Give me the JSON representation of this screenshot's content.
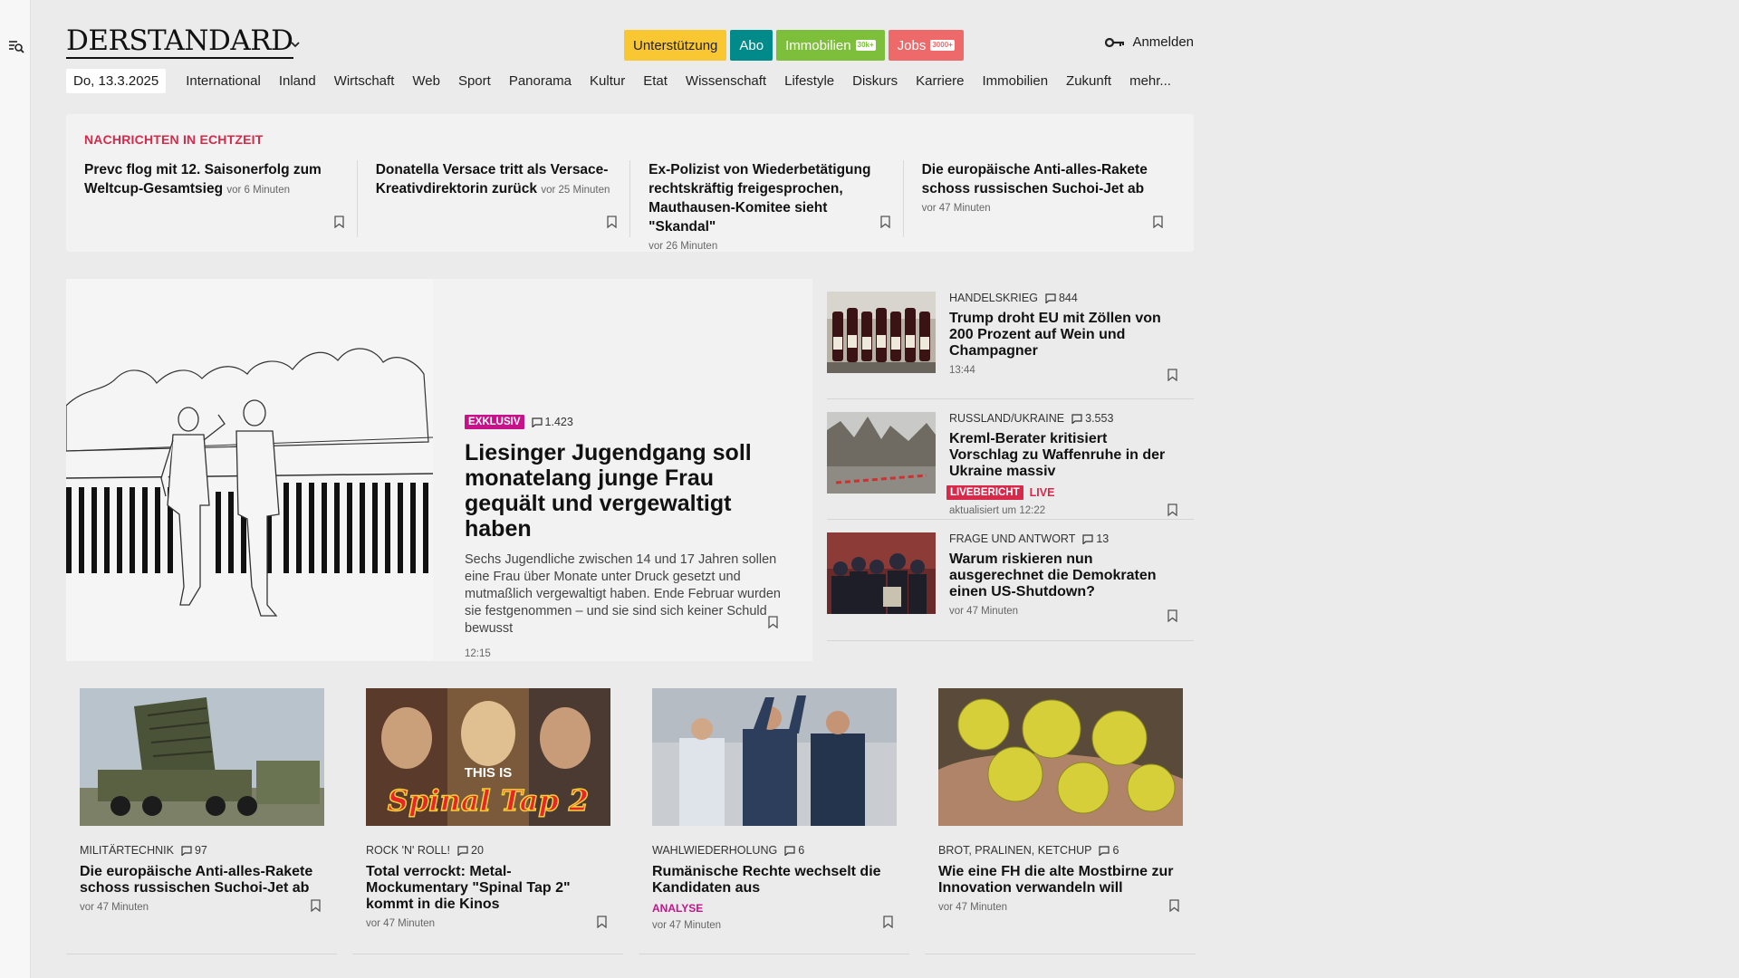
{
  "header": {
    "logo": "DERSTANDARD",
    "buttons": {
      "support": "Unterstützung",
      "abo": "Abo",
      "immobilien": "Immobilien",
      "immobilien_badge": "30k+",
      "jobs": "Jobs",
      "jobs_badge": "3000+"
    },
    "login": "Anmelden"
  },
  "nav": {
    "date": "Do, 13.3.2025",
    "items": [
      "International",
      "Inland",
      "Wirtschaft",
      "Web",
      "Sport",
      "Panorama",
      "Kultur",
      "Etat",
      "Wissenschaft",
      "Lifestyle",
      "Diskurs",
      "Karriere",
      "Immobilien",
      "Zukunft",
      "mehr..."
    ]
  },
  "realtime": {
    "title": "NACHRICHTEN IN ECHTZEIT",
    "items": [
      {
        "headline": "Prevc flog mit 12. Saisonerfolg zum Weltcup-Gesamtsieg",
        "time": "vor 6 Minuten"
      },
      {
        "headline": "Donatella Versace tritt als Versace-Kreativdirektorin zurück",
        "time": "vor 25 Minuten"
      },
      {
        "headline": "Ex-Polizist von Wiederbetätigung rechtskräftig freigesprochen, Mauthausen-Komitee sieht \"Skandal\"",
        "time": "vor 26 Minuten"
      },
      {
        "headline": "Die europäische Anti-alles-Rakete schoss russischen Suchoi-Jet ab",
        "time": "vor 47 Minuten"
      }
    ]
  },
  "hero": {
    "tag": "EXKLUSIV",
    "comments": "1.423",
    "title": "Liesinger Jugendgang soll monatelang junge Frau gequält und vergewaltigt haben",
    "teaser": "Sechs Jugendliche zwischen 14 und 17 Jahren sollen eine Frau über Monate unter Druck gesetzt und mutmaßlich vergewaltigt haben. Ende Februar wurden sie festgenommen – und sie sind sich keiner Schuld bewusst",
    "time": "12:15"
  },
  "side": [
    {
      "kicker": "Handelskrieg",
      "comments": "844",
      "title": "Trump droht EU mit Zöllen von 200 Prozent auf Wein und Champagner",
      "meta": "13:44"
    },
    {
      "kicker": "Russland/Ukraine",
      "comments": "3.553",
      "title": "Kreml-Berater kritisiert Vorschlag zu Waffenruhe in der Ukraine massiv",
      "live_tag": "LIVEBERICHT",
      "live_text": "LIVE",
      "meta": "aktualisiert um 12:22"
    },
    {
      "kicker": "Frage und Antwort",
      "comments": "13",
      "title": "Warum riskieren nun ausgerechnet die Demokraten einen US-Shutdown?",
      "meta": "vor 47 Minuten"
    }
  ],
  "cards": [
    {
      "kicker": "Militärtechnik",
      "comments": "97",
      "title": "Die europäische Anti-alles-Rakete schoss russischen Suchoi-Jet ab",
      "meta": "vor 47 Minuten"
    },
    {
      "kicker": "Rock 'n' Roll!",
      "comments": "20",
      "title": "Total verrockt: Metal-Mockumentary \"Spinal Tap 2\" kommt in die Kinos",
      "meta": "vor 47 Minuten",
      "image_text_1": "THIS IS",
      "image_text_2": "Spinal Tap 2"
    },
    {
      "kicker": "Wahlwiederholung",
      "comments": "6",
      "title": "Rumänische Rechte wechselt die Kandidaten aus",
      "analyse": "ANALYSE",
      "meta": "vor 47 Minuten"
    },
    {
      "kicker": "Brot, Pralinen, Ketchup",
      "comments": "6",
      "title": "Wie eine FH die alte Mostbirne zur Innovation verwandeln will",
      "meta": "vor 47 Minuten"
    }
  ],
  "icons": {
    "menu_search": "menu-search-icon",
    "chevron": "chevron-down-icon",
    "key": "key-icon",
    "comment": "comment-icon",
    "bookmark": "bookmark-icon"
  },
  "colors": {
    "realtime_title": "#d8294b",
    "exklusiv": "#c8128a",
    "live": "#d8294b",
    "support": "#f8c732",
    "abo": "#008a8a",
    "immobilien": "#7dbf3a",
    "jobs": "#ee6a6a"
  }
}
